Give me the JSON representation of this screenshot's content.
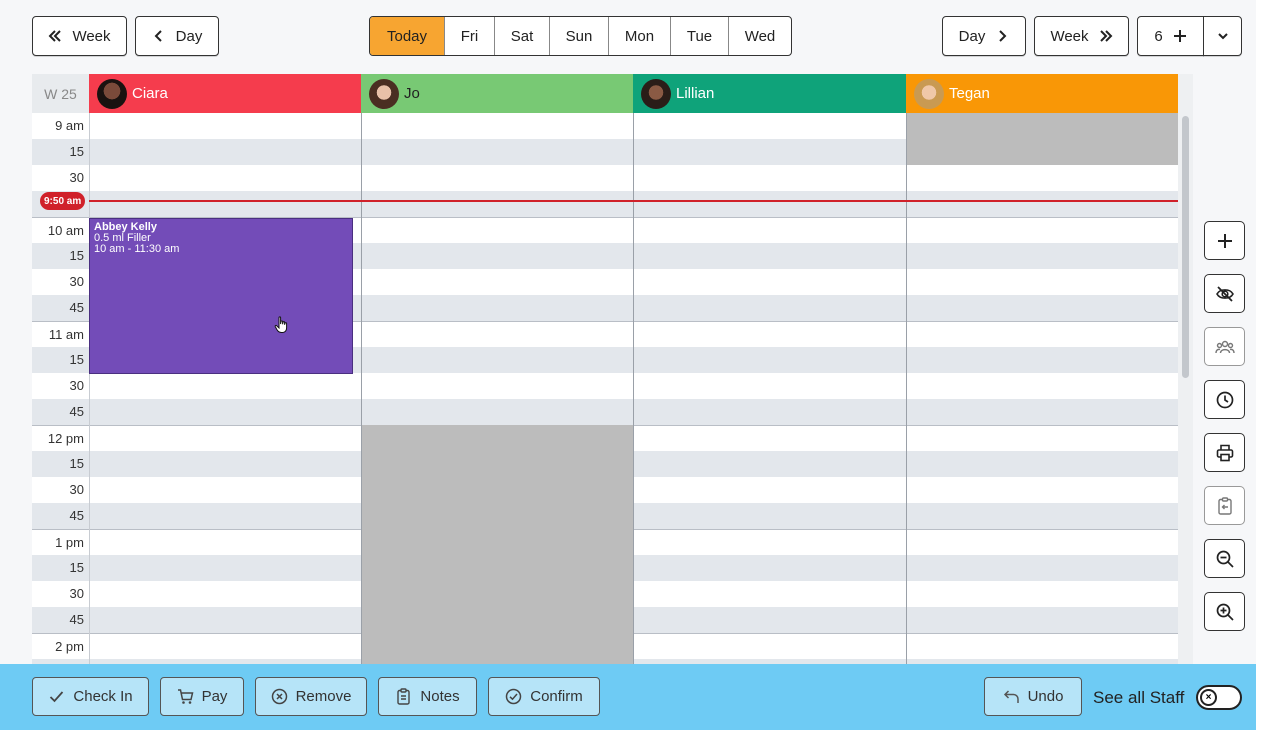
{
  "nav": {
    "prev_week": "Week",
    "prev_day": "Day",
    "days": [
      "Today",
      "Fri",
      "Sat",
      "Sun",
      "Mon",
      "Tue",
      "Wed"
    ],
    "active_day": "Today",
    "next_day": "Day",
    "next_week": "Week",
    "count": "6"
  },
  "grid": {
    "week_label": "W 25",
    "staff": [
      {
        "name": "Ciara",
        "color": "#f53c4d"
      },
      {
        "name": "Jo",
        "color": "#78c974"
      },
      {
        "name": "Lillian",
        "color": "#0fa37a"
      },
      {
        "name": "Tegan",
        "color": "#f99706"
      }
    ],
    "time_labels": [
      "9 am",
      "15",
      "30",
      "",
      "10 am",
      "15",
      "30",
      "45",
      "11 am",
      "15",
      "30",
      "45",
      "12 pm",
      "15",
      "30",
      "45",
      "1 pm",
      "15",
      "30",
      "45",
      "2 pm"
    ],
    "now": "9:50 am"
  },
  "appointment": {
    "client": "Abbey Kelly",
    "service": "0.5 ml Filler",
    "time": "10 am - 11:30 am",
    "color": "#734cb8"
  },
  "side_tools": [
    "plus-icon",
    "eye-off-icon",
    "group-icon",
    "clock-icon",
    "printer-icon",
    "clipboard-icon",
    "zoom-out-icon",
    "zoom-in-icon"
  ],
  "footer": {
    "check_in": "Check In",
    "pay": "Pay",
    "remove": "Remove",
    "notes": "Notes",
    "confirm": "Confirm",
    "undo": "Undo",
    "see_all_staff": "See all Staff"
  }
}
